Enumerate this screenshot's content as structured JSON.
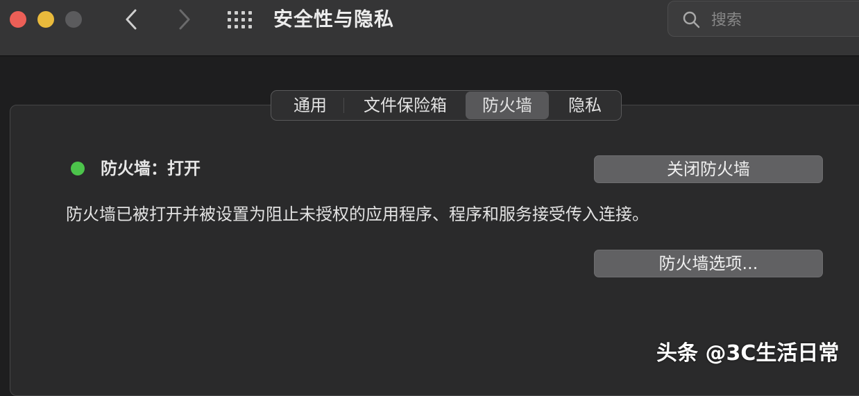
{
  "window": {
    "title": "安全性与隐私"
  },
  "toolbar": {
    "back_icon": "chevron-left-icon",
    "forward_icon": "chevron-right-icon",
    "show_all_icon": "grid-icon"
  },
  "search": {
    "placeholder": "搜索",
    "value": ""
  },
  "tabs": [
    {
      "label": "通用",
      "selected": false
    },
    {
      "label": "文件保险箱",
      "selected": false
    },
    {
      "label": "防火墙",
      "selected": true
    },
    {
      "label": "隐私",
      "selected": false
    }
  ],
  "firewall": {
    "status_label": "防火墙：打开",
    "status_color": "#4cc44b",
    "turn_off_button": "关闭防火墙",
    "description": "防火墙已被打开并被设置为阻止未授权的应用程序、程序和服务接受传入连接。",
    "options_button": "防火墙选项..."
  },
  "watermark": {
    "text": "头条 @3C生活日常"
  },
  "colors": {
    "close": "#ec5f57",
    "minimize": "#e9ba3c",
    "zoom_disabled": "#5b5b5d"
  }
}
